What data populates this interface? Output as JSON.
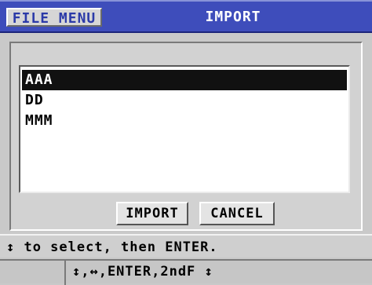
{
  "titlebar": {
    "menu_label": "FILE MENU",
    "title": "IMPORT"
  },
  "list": {
    "items": [
      {
        "label": "AAA",
        "selected": true
      },
      {
        "label": "DD",
        "selected": false
      },
      {
        "label": "MMM",
        "selected": false
      }
    ]
  },
  "buttons": {
    "import_label": "IMPORT",
    "cancel_label": "CANCEL"
  },
  "status": {
    "text": "↕ to select, then ENTER."
  },
  "footer": {
    "keys": "↕,↔,ENTER,2ndF ↕"
  },
  "colors": {
    "titlebar": "#3e4dbb",
    "selection": "#111111",
    "background": "#c9c9c9"
  }
}
